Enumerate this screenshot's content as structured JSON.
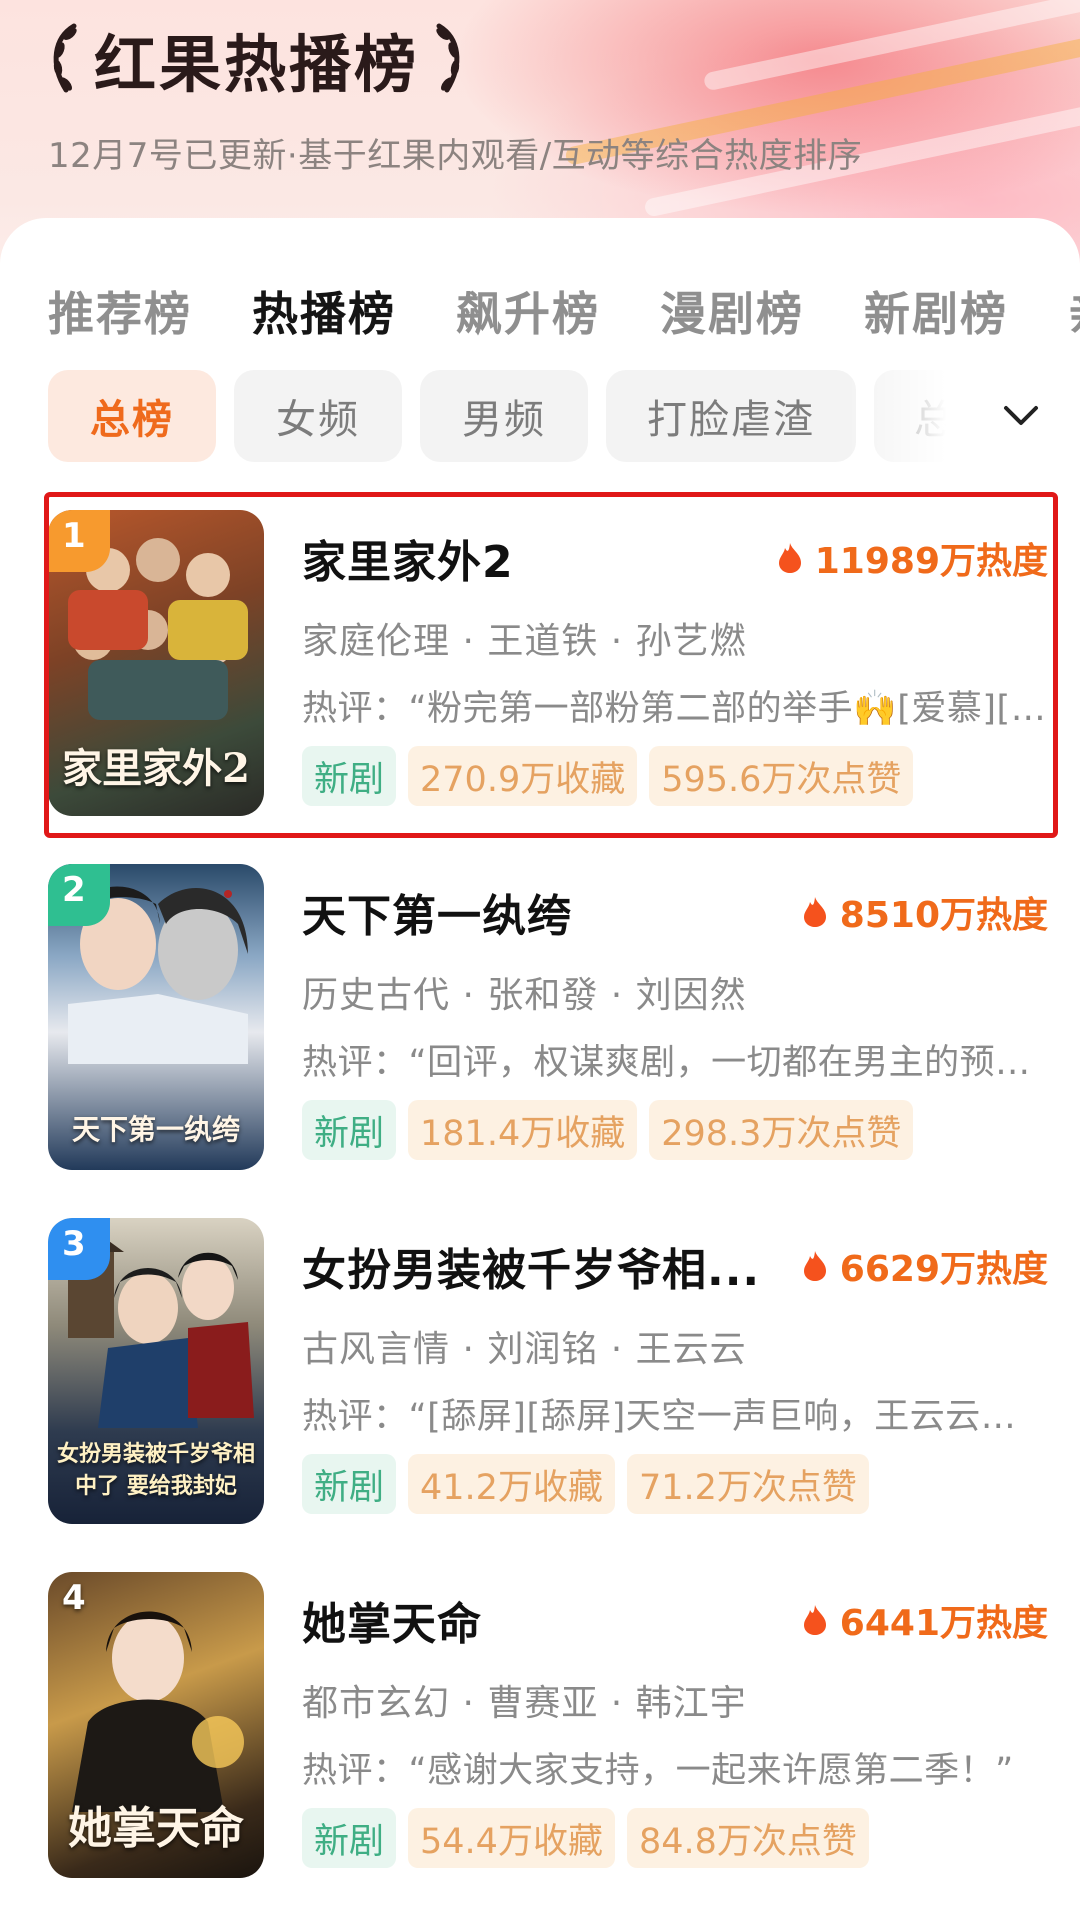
{
  "header": {
    "title": "红果热播榜",
    "subtitle": "12月7号已更新·基于红果内观看/互动等综合热度排序"
  },
  "tabs": [
    {
      "label": "推荐榜",
      "active": false
    },
    {
      "label": "热播榜",
      "active": true
    },
    {
      "label": "飙升榜",
      "active": false
    },
    {
      "label": "漫剧榜",
      "active": false
    },
    {
      "label": "新剧榜",
      "active": false
    },
    {
      "label": "亲",
      "active": false
    }
  ],
  "chips": [
    {
      "label": "总榜",
      "active": true
    },
    {
      "label": "女频",
      "active": false
    },
    {
      "label": "男频",
      "active": false
    },
    {
      "label": "打脸虐渣",
      "active": false
    },
    {
      "label": "总",
      "active": false
    }
  ],
  "colors": {
    "accent": "#ef6a1c",
    "rank1": "#f79a2e",
    "rank2": "#2fbf91",
    "rank3": "#2f8ff0",
    "highlight": "#e01818"
  },
  "dramas": [
    {
      "rank": "1",
      "title": "家里家外2",
      "heat": "11989万热度",
      "meta": "家庭伦理 · 王道铁 · 孙艺燃",
      "review": "热评：“粉完第一部粉第二部的举手🙌[爱慕][爱慕]”",
      "tag": "新剧",
      "favorites": "270.9万收藏",
      "likes": "595.6万次点赞",
      "cover_text": "家里家外2"
    },
    {
      "rank": "2",
      "title": "天下第一纨绔",
      "heat": "8510万热度",
      "meta": "历史古代 · 张和發 · 刘因然",
      "review": "热评：“回评，权谋爽剧，一切都在男主的预料之中”",
      "tag": "新剧",
      "favorites": "181.4万收藏",
      "likes": "298.3万次点赞",
      "cover_text": "天下第一纨绔"
    },
    {
      "rank": "3",
      "title": "女扮男装被千岁爷相...",
      "heat": "6629万热度",
      "meta": "古风言情 · 刘润铭 · 王云云",
      "review": "热评：“[舔屏][舔屏]天空一声巨响，王云云闪亮登场”",
      "tag": "新剧",
      "favorites": "41.2万收藏",
      "likes": "71.2万次点赞",
      "cover_text": "女扮男装被千岁爷相中了 要给我封妃"
    },
    {
      "rank": "4",
      "title": "她掌天命",
      "heat": "6441万热度",
      "meta": "都市玄幻 · 曹赛亚 · 韩江宇",
      "review": "热评：“感谢大家支持，一起来许愿第二季！”",
      "tag": "新剧",
      "favorites": "54.4万收藏",
      "likes": "84.8万次点赞",
      "cover_text": "她掌天命"
    }
  ]
}
